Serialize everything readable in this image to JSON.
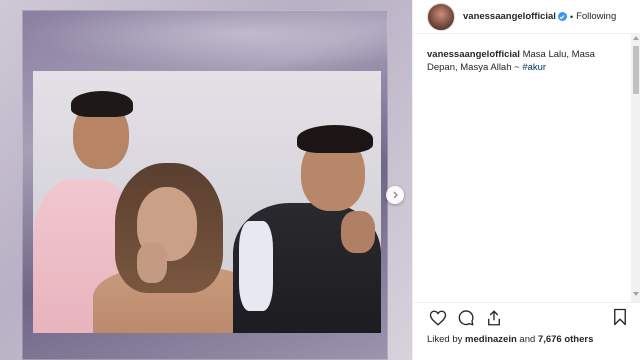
{
  "post": {
    "username": "vanessaangelofficial",
    "separator": "•",
    "follow_label": "Following",
    "caption": {
      "user": "vanessaangelofficial",
      "text": " Masa Lalu, Masa Depan, Masya Allah ~ ",
      "hashtag": "#akur"
    },
    "likes": {
      "prefix": "Liked by ",
      "user": "medinazein",
      "middle": " and ",
      "count": "7,676 others"
    }
  },
  "icons": {
    "next": "chevron-right-icon",
    "like": "heart-icon",
    "comment": "comment-icon",
    "share": "share-icon",
    "save": "bookmark-icon",
    "verified": "verified-badge-icon"
  },
  "colors": {
    "verified": "#3897f0",
    "hashtag": "#003569",
    "text": "#262626"
  }
}
